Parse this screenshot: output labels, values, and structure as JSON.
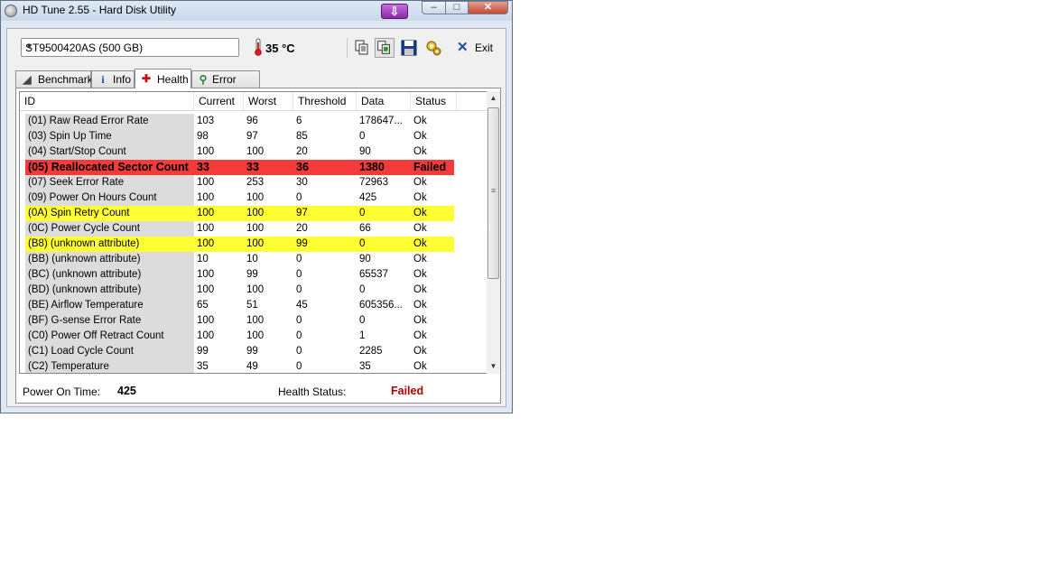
{
  "window": {
    "title": "HD Tune 2.55 - Hard Disk Utility",
    "controls": {
      "minimize": "–",
      "maximize": "□",
      "close": "✕"
    },
    "download_glyph": "⇩"
  },
  "toolbar": {
    "drive": "ST9500420AS (500 GB)",
    "dropdown_glyph": "▼",
    "temperature": "35 °C",
    "buttons": [
      "copy-text-icon",
      "copy-screenshot-icon",
      "save-icon",
      "options-icon"
    ],
    "exit_glyph": "✕",
    "exit_label": "Exit"
  },
  "tabs": [
    {
      "label": "Benchmark",
      "icon": "benchmark-icon",
      "glyph": "◢"
    },
    {
      "label": "Info",
      "icon": "info-icon",
      "glyph": "i"
    },
    {
      "label": "Health",
      "icon": "health-cross-icon",
      "glyph": "✚",
      "active": true
    },
    {
      "label": "Error Scan",
      "icon": "magnifier-icon",
      "glyph": "⚲"
    }
  ],
  "table": {
    "columns": [
      "ID",
      "Current",
      "Worst",
      "Threshold",
      "Data",
      "Status"
    ],
    "rows": [
      {
        "id": "(01) Raw Read Error Rate",
        "current": "103",
        "worst": "96",
        "threshold": "6",
        "data": "178647...",
        "status": "Ok"
      },
      {
        "id": "(03) Spin Up Time",
        "current": "98",
        "worst": "97",
        "threshold": "85",
        "data": "0",
        "status": "Ok"
      },
      {
        "id": "(04) Start/Stop Count",
        "current": "100",
        "worst": "100",
        "threshold": "20",
        "data": "90",
        "status": "Ok"
      },
      {
        "id": "(05) Reallocated Sector Count",
        "current": "33",
        "worst": "33",
        "threshold": "36",
        "data": "1380",
        "status": "Failed",
        "highlight": "red"
      },
      {
        "id": "(07) Seek Error Rate",
        "current": "100",
        "worst": "253",
        "threshold": "30",
        "data": "72963",
        "status": "Ok"
      },
      {
        "id": "(09) Power On Hours Count",
        "current": "100",
        "worst": "100",
        "threshold": "0",
        "data": "425",
        "status": "Ok"
      },
      {
        "id": "(0A) Spin Retry Count",
        "current": "100",
        "worst": "100",
        "threshold": "97",
        "data": "0",
        "status": "Ok",
        "highlight": "yellow"
      },
      {
        "id": "(0C) Power Cycle Count",
        "current": "100",
        "worst": "100",
        "threshold": "20",
        "data": "66",
        "status": "Ok"
      },
      {
        "id": "(B8) (unknown attribute)",
        "current": "100",
        "worst": "100",
        "threshold": "99",
        "data": "0",
        "status": "Ok",
        "highlight": "yellow"
      },
      {
        "id": "(BB) (unknown attribute)",
        "current": "10",
        "worst": "10",
        "threshold": "0",
        "data": "90",
        "status": "Ok"
      },
      {
        "id": "(BC) (unknown attribute)",
        "current": "100",
        "worst": "99",
        "threshold": "0",
        "data": "65537",
        "status": "Ok"
      },
      {
        "id": "(BD) (unknown attribute)",
        "current": "100",
        "worst": "100",
        "threshold": "0",
        "data": "0",
        "status": "Ok"
      },
      {
        "id": "(BE) Airflow Temperature",
        "current": "65",
        "worst": "51",
        "threshold": "45",
        "data": "605356...",
        "status": "Ok"
      },
      {
        "id": "(BF) G-sense Error Rate",
        "current": "100",
        "worst": "100",
        "threshold": "0",
        "data": "0",
        "status": "Ok"
      },
      {
        "id": "(C0) Power Off Retract Count",
        "current": "100",
        "worst": "100",
        "threshold": "0",
        "data": "1",
        "status": "Ok"
      },
      {
        "id": "(C1) Load Cycle Count",
        "current": "99",
        "worst": "99",
        "threshold": "0",
        "data": "2285",
        "status": "Ok"
      },
      {
        "id": "(C2) Temperature",
        "current": "35",
        "worst": "49",
        "threshold": "0",
        "data": "35",
        "status": "Ok"
      }
    ]
  },
  "scrollbar": {
    "up_glyph": "▲",
    "down_glyph": "▼",
    "grip_glyph": "≡"
  },
  "footer": {
    "power_on_label": "Power On Time:",
    "power_on_value": "425",
    "health_label": "Health Status:",
    "health_value": "Failed"
  },
  "colors": {
    "failed_row": "#f33b3b",
    "warning_row": "#ffff33",
    "failed_text": "#b00000"
  }
}
